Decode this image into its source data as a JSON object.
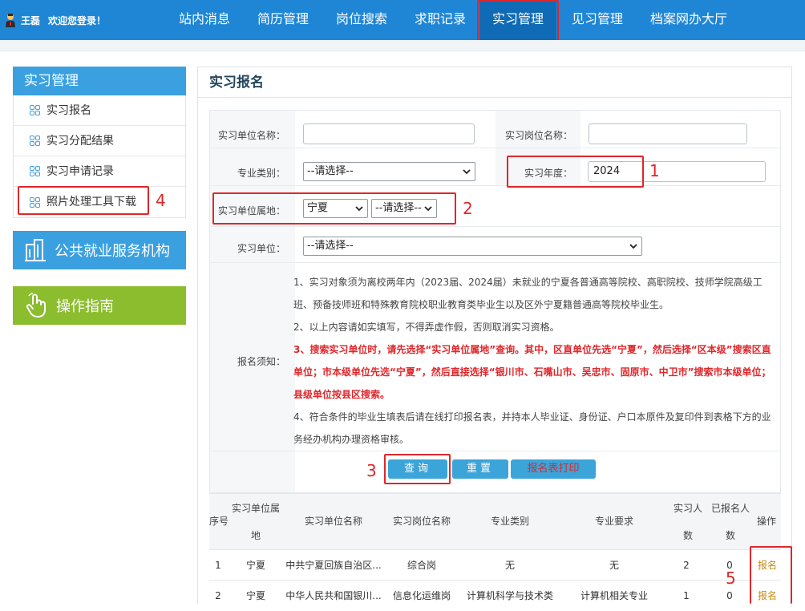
{
  "header": {
    "user_name": "王磊",
    "welcome": "欢迎您登录！",
    "nav": [
      {
        "label": "站内消息"
      },
      {
        "label": "简历管理"
      },
      {
        "label": "岗位搜索"
      },
      {
        "label": "求职记录"
      },
      {
        "label": "实习管理",
        "active": true
      },
      {
        "label": "见习管理"
      },
      {
        "label": "档案网办大厅"
      }
    ]
  },
  "sidebar": {
    "title": "实习管理",
    "items": [
      {
        "label": "实习报名"
      },
      {
        "label": "实习分配结果"
      },
      {
        "label": "实习申请记录"
      },
      {
        "label": "照片处理工具下载"
      }
    ],
    "btn_public": "公共就业服务机构",
    "btn_guide": "操作指南"
  },
  "panel": {
    "title": "实习报名"
  },
  "form": {
    "unit_name_label": "实习单位名称：",
    "unit_name_value": "",
    "post_name_label": "实习岗位名称：",
    "post_name_value": "",
    "major_label": "专业类别：",
    "major_value": "--请选择--",
    "year_label": "实习年度：",
    "year_value": "2024",
    "region_label": "实习单位属地：",
    "region_value": "宁夏",
    "region_sub_value": "--请选择--",
    "unit_label": "实习单位：",
    "unit_value": "--请选择--",
    "notice_label": "报名须知："
  },
  "notes": {
    "n1": "1、实习对象须为离校两年内（2023届、2024届）未就业的宁夏各普通高等院校、高职院校、技师学院高级工班、预备技师班和特殊教育院校职业教育类毕业生以及区外宁夏籍普通高等院校毕业生。",
    "n2": "2、以上内容请如实填写，不得弄虚作假，否则取消实习资格。",
    "n3": "3、搜索实习单位时，请先选择“实习单位属地”查询。其中，区直单位先选“宁夏”，然后选择“区本级”搜索区直单位；市本级单位先选“宁夏”，然后直接选择“银川市、石嘴山市、吴忠市、固原市、中卫市”搜索市本级单位；县级单位按县区搜索。",
    "n4": "4、符合条件的毕业生填表后请在线打印报名表，并持本人毕业证、身份证、户口本原件及复印件到表格下方的业务经办机构办理资格审核。"
  },
  "buttons": {
    "query": "查询",
    "reset": "重置",
    "print": "报名表打印"
  },
  "markers": [
    "1",
    "2",
    "3",
    "4",
    "5"
  ],
  "table": {
    "headers": {
      "seq": "序号",
      "region_1": "实习单位属",
      "region_2": "地",
      "unit": "实习单位名称",
      "post": "实习岗位名称",
      "major": "专业类别",
      "req": "专业要求",
      "count_1": "实习人",
      "count_2": "数",
      "enrolled_1": "已报名人",
      "enrolled_2": "数",
      "op": "操作"
    },
    "rows": [
      {
        "seq": "1",
        "region": "宁夏",
        "unit": "中共宁夏回族自治区...",
        "post": "综合岗",
        "major": "无",
        "req": "无",
        "count": "2",
        "enrolled": "0",
        "op": "报名"
      },
      {
        "seq": "2",
        "region": "宁夏",
        "unit": "中华人民共和国银川...",
        "post": "信息化运维岗",
        "major": "计算机科学与技术类",
        "req": "计算机相关专业",
        "count": "1",
        "enrolled": "0",
        "op": "报名"
      }
    ]
  }
}
